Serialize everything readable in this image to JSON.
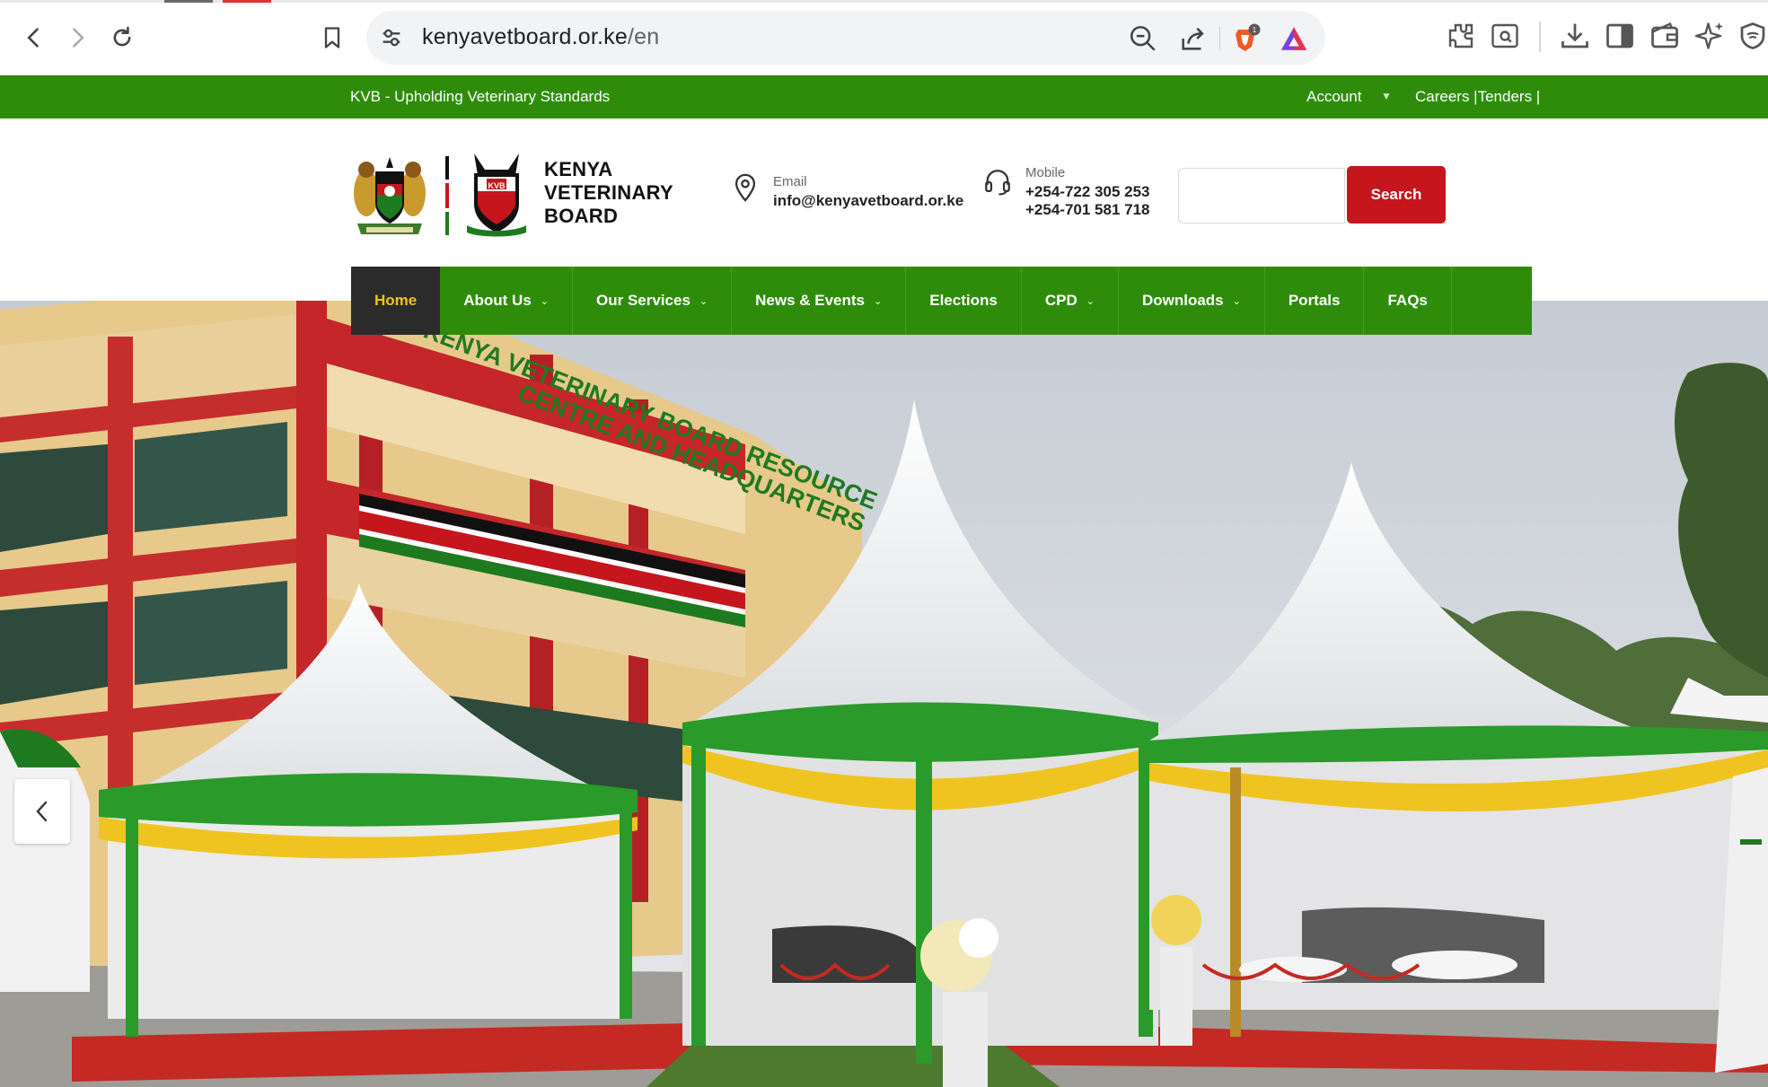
{
  "browser": {
    "url_host": "kenyavetboard.or.ke",
    "url_path": "/en",
    "shield_badge": "1"
  },
  "topbar": {
    "tagline": "KVB - Upholding Veterinary Standards",
    "account": "Account",
    "careers": "Careers |Tenders |"
  },
  "header": {
    "brand_line1": "KENYA",
    "brand_line2": "VETERINARY",
    "brand_line3": "BOARD",
    "email_label": "Email",
    "email_value": "info@kenyavetboard.or.ke",
    "mobile_label": "Mobile",
    "mobile_1": "+254-722 305 253",
    "mobile_2": "+254-701 581 718",
    "search_placeholder": "",
    "search_button": "Search"
  },
  "nav": {
    "items": [
      {
        "label": "Home",
        "has_dropdown": false,
        "active": true
      },
      {
        "label": "About Us",
        "has_dropdown": true
      },
      {
        "label": "Our Services",
        "has_dropdown": true
      },
      {
        "label": "News & Events",
        "has_dropdown": true
      },
      {
        "label": "Elections",
        "has_dropdown": false
      },
      {
        "label": "CPD",
        "has_dropdown": true
      },
      {
        "label": "Downloads",
        "has_dropdown": true
      },
      {
        "label": "Portals",
        "has_dropdown": false
      },
      {
        "label": "FAQs",
        "has_dropdown": false
      }
    ]
  },
  "hero": {
    "building_sign_line1": "KENYA VETERINARY BOARD RESOURCE",
    "building_sign_line2": "CENTRE AND HEADQUARTERS"
  },
  "colors": {
    "brand_green": "#2f8c0a",
    "search_red": "#c5161d",
    "active_nav_bg": "#2b2b2b",
    "active_nav_text": "#f3c316"
  }
}
